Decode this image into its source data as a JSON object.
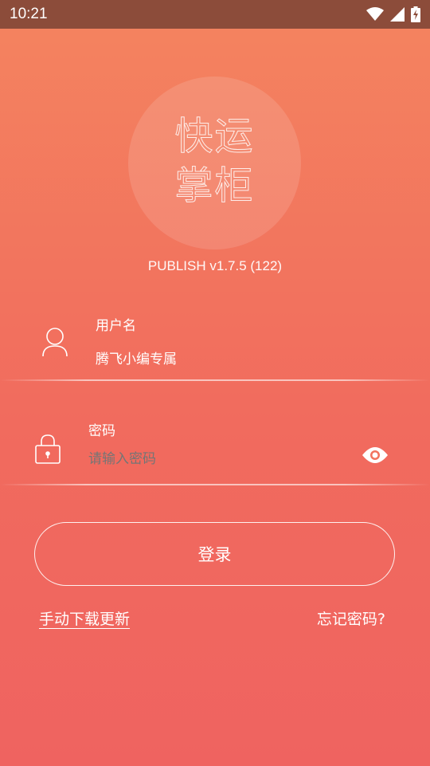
{
  "status_bar": {
    "time": "10:21",
    "icons": [
      "wifi-icon",
      "cellular-signal-icon",
      "battery-charging-icon"
    ]
  },
  "logo": {
    "line1": "快运",
    "line2": "掌柜"
  },
  "version": "PUBLISH v1.7.5 (122)",
  "username": {
    "label": "用户名",
    "value": "腾飞小编专属",
    "icon": "user-icon"
  },
  "password": {
    "label": "密码",
    "placeholder": "请输入密码",
    "icon": "lock-icon",
    "toggle_icon": "eye-icon"
  },
  "actions": {
    "login": "登录",
    "download": "手动下载更新",
    "forgot": "忘记密码?"
  },
  "colors": {
    "background_top": "#f4845f",
    "background_bottom": "#ef6360",
    "status_bar": "#8c4c3a"
  }
}
